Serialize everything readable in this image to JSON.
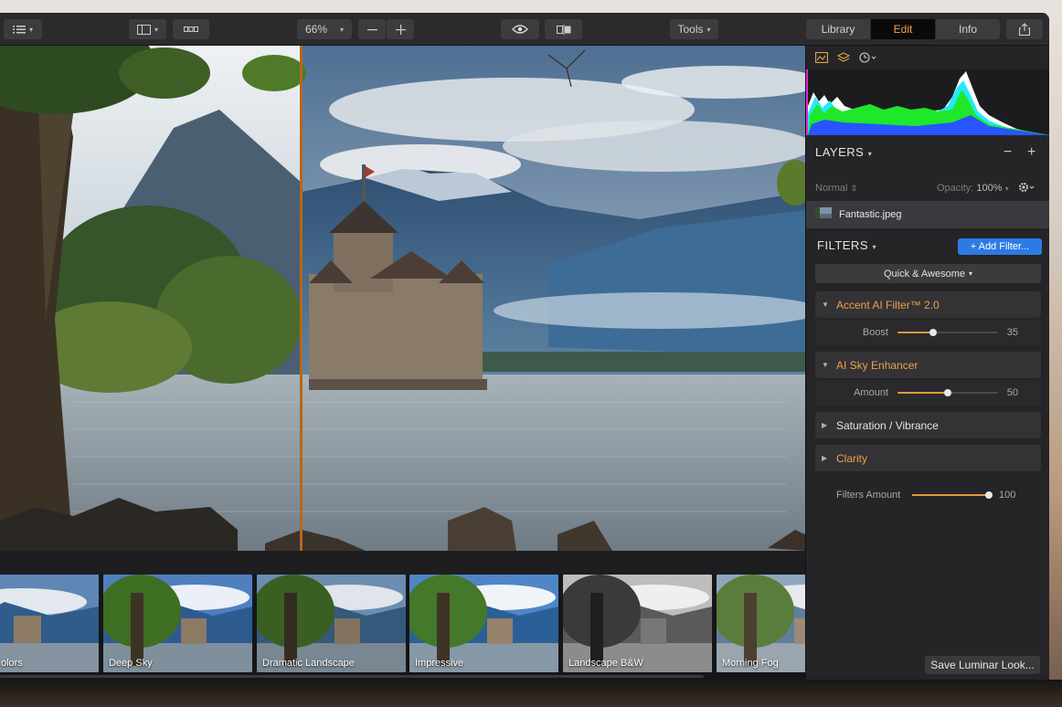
{
  "toolbar": {
    "zoom": "66%",
    "tools_label": "Tools",
    "tabs": [
      {
        "label": "Library",
        "active": false
      },
      {
        "label": "Edit",
        "active": true
      },
      {
        "label": "Info",
        "active": false
      }
    ],
    "icons": {
      "menu": "list-icon",
      "sidebar": "sidebar-layout-icon",
      "filmstrip": "filmstrip-icon",
      "zoom_out": "minus-icon",
      "zoom_in": "plus-icon",
      "preview": "eye-icon",
      "compare": "split-compare-icon",
      "share": "share-icon"
    }
  },
  "layers": {
    "title": "LAYERS",
    "blend_mode": "Normal",
    "opacity_label": "Opacity:",
    "opacity_value": "100%",
    "layer_name": "Fantastic.jpeg"
  },
  "filters": {
    "title": "FILTERS",
    "add_button": "+ Add Filter...",
    "quick_button": "Quick & Awesome",
    "items": [
      {
        "name": "Accent AI Filter™ 2.0",
        "expanded": true,
        "slider_label": "Boost",
        "value": "35",
        "fraction": 0.35
      },
      {
        "name": "AI Sky Enhancer",
        "expanded": true,
        "slider_label": "Amount",
        "value": "50",
        "fraction": 0.5
      },
      {
        "name": "Saturation / Vibrance",
        "expanded": false
      },
      {
        "name": "Clarity",
        "expanded": false
      }
    ],
    "amount_label": "Filters Amount",
    "amount_value": "100",
    "amount_fraction": 1.0
  },
  "looks": {
    "items": [
      "olors",
      "Deep Sky",
      "Dramatic Landscape",
      "Impressive",
      "Landscape B&W",
      "Morning Fog"
    ],
    "save_button": "Save Luminar Look..."
  },
  "colors": {
    "accent_orange": "#eda24a",
    "add_blue": "#2c7be5",
    "split_line": "#b9661b"
  }
}
